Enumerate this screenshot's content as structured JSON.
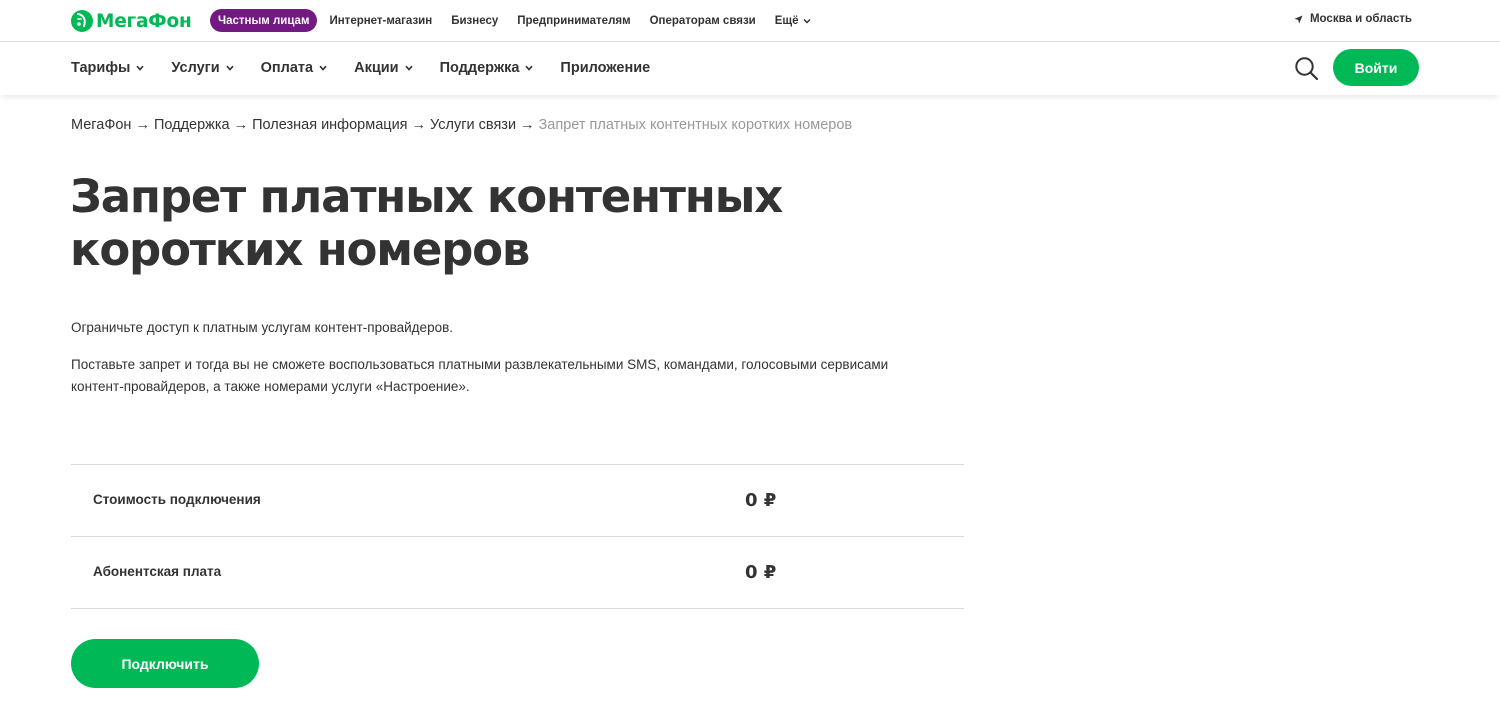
{
  "brand": {
    "logo_text": "МегаФон",
    "accent_color": "#00b956",
    "segment_active_color": "#731982"
  },
  "topbar": {
    "segments": [
      {
        "label": "Частным лицам",
        "active": true
      },
      {
        "label": "Интернет-магазин"
      },
      {
        "label": "Бизнесу"
      },
      {
        "label": "Предпринимателям"
      },
      {
        "label": "Операторам связи"
      },
      {
        "label": "Ещё"
      }
    ],
    "region": "Москва и область"
  },
  "mainnav": {
    "items": [
      {
        "label": "Тарифы"
      },
      {
        "label": "Услуги"
      },
      {
        "label": "Оплата"
      },
      {
        "label": "Акции"
      },
      {
        "label": "Поддержка"
      },
      {
        "label": "Приложение"
      }
    ],
    "login_label": "Войти"
  },
  "breadcrumb": {
    "items": [
      "МегаФон",
      "Поддержка",
      "Полезная информация",
      "Услуги связи"
    ],
    "separator": "→",
    "current": "Запрет платных контентных коротких номеров"
  },
  "page": {
    "title_line1": "Запрет платных контентных",
    "title_line2": "коротких номеров",
    "paragraph1": "Ограничьте доступ к платным услугам контент-провайдеров.",
    "paragraph2_line1": "Поставьте запрет и тогда вы не сможете воспользоваться платными развлекательными SMS, командами, голосовыми сервисами",
    "paragraph2_line2": "контент-провайдеров, а также номерами услуги «Настроение».",
    "prices": [
      {
        "label": "Стоимость подключения",
        "value": "0 ₽"
      },
      {
        "label": "Абонентская плата",
        "value": "0 ₽"
      }
    ],
    "connect_label": "Подключить"
  }
}
